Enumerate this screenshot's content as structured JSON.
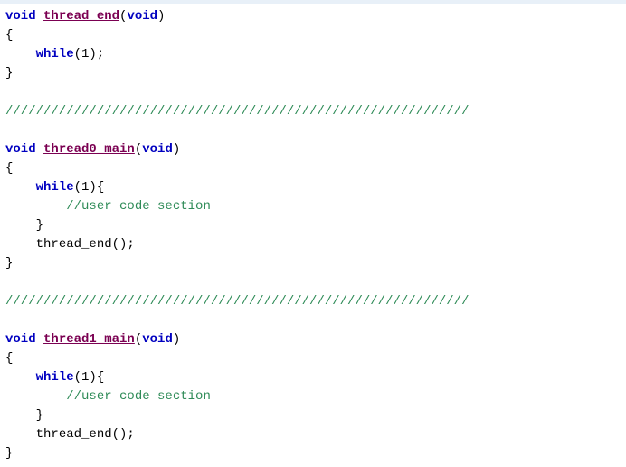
{
  "code": {
    "l1_kw1": "void",
    "l1_fn": "thread_end",
    "l1_paren_open": "(",
    "l1_kw2": "void",
    "l1_paren_close": ")",
    "l2_brace": "{",
    "l3_indent": "    ",
    "l3_kw": "while",
    "l3_rest": "(1);",
    "l4_brace": "}",
    "l5_blank": " ",
    "l6_sep": "/////////////////////////////////////////////////////////////",
    "l7_blank": " ",
    "l8_kw1": "void",
    "l8_fn": "thread0_main",
    "l8_paren_open": "(",
    "l8_kw2": "void",
    "l8_paren_close": ")",
    "l9_brace": "{",
    "l10_indent": "    ",
    "l10_kw": "while",
    "l10_rest": "(1){",
    "l11_indent": "        ",
    "l11_cm": "//user code section",
    "l12_indent": "    ",
    "l12_brace": "}",
    "l13_indent": "    ",
    "l13_call": "thread_end();",
    "l14_brace": "}",
    "l15_blank": " ",
    "l16_sep": "/////////////////////////////////////////////////////////////",
    "l17_blank": " ",
    "l18_kw1": "void",
    "l18_fn": "thread1_main",
    "l18_paren_open": "(",
    "l18_kw2": "void",
    "l18_paren_close": ")",
    "l19_brace": "{",
    "l20_indent": "    ",
    "l20_kw": "while",
    "l20_rest": "(1){",
    "l21_indent": "        ",
    "l21_cm": "//user code section",
    "l22_indent": "    ",
    "l22_brace": "}",
    "l23_indent": "    ",
    "l23_call": "thread_end();",
    "l24_brace": "}"
  }
}
